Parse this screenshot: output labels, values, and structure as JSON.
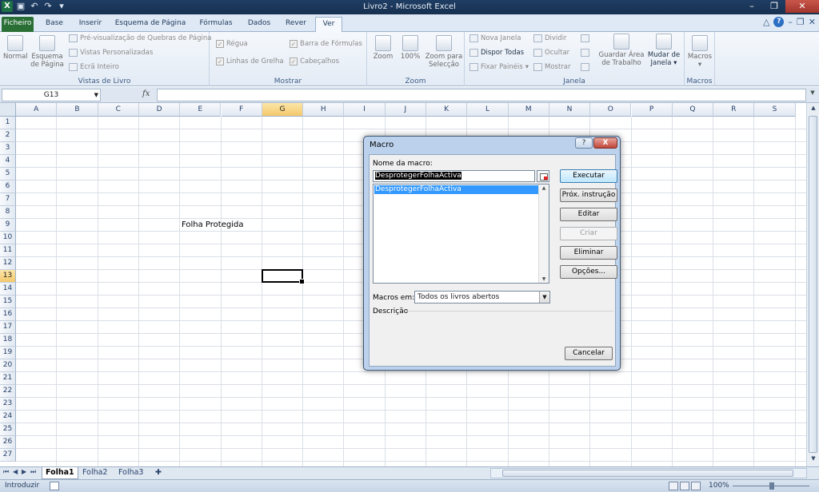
{
  "window": {
    "title": "Livro2 - Microsoft Excel"
  },
  "tabs": [
    {
      "label": "Ficheiro"
    },
    {
      "label": "Base"
    },
    {
      "label": "Inserir"
    },
    {
      "label": "Esquema de Página"
    },
    {
      "label": "Fórmulas"
    },
    {
      "label": "Dados"
    },
    {
      "label": "Rever"
    },
    {
      "label": "Ver"
    }
  ],
  "ribbon": {
    "workbook_views": {
      "label": "Vistas de Livro",
      "normal": "Normal",
      "page_layout_1": "Esquema",
      "page_layout_2": "de Página",
      "page_break_preview": "Pré-visualização de Quebras de Página",
      "custom_views": "Vistas Personalizadas",
      "full_screen": "Ecrã Inteiro"
    },
    "show": {
      "label": "Mostrar",
      "ruler": "Régua",
      "gridlines": "Linhas de Grelha",
      "formula_bar": "Barra de Fórmulas",
      "headings": "Cabeçalhos"
    },
    "zoom": {
      "label": "Zoom",
      "zoom": "Zoom",
      "hundred": "100%",
      "zoom_selection_1": "Zoom para",
      "zoom_selection_2": "Selecção"
    },
    "window": {
      "label": "Janela",
      "new_window": "Nova Janela",
      "arrange_all": "Dispor Todas",
      "freeze_panes": "Fixar Painéis",
      "split": "Dividir",
      "hide": "Ocultar",
      "unhide": "Mostrar",
      "save_workspace_1": "Guardar Área",
      "save_workspace_2": "de Trabalho",
      "switch_windows_1": "Mudar de",
      "switch_windows_2": "Janela"
    },
    "macros": {
      "label": "Macros",
      "macros": "Macros"
    }
  },
  "formula_bar": {
    "name_box": "G13",
    "fx": "fx",
    "formula": ""
  },
  "grid": {
    "columns": [
      "A",
      "B",
      "C",
      "D",
      "E",
      "F",
      "G",
      "H",
      "I",
      "J",
      "K",
      "L",
      "M",
      "N",
      "O",
      "P",
      "Q",
      "R",
      "S"
    ],
    "rows": [
      "1",
      "2",
      "3",
      "4",
      "5",
      "6",
      "7",
      "8",
      "9",
      "10",
      "11",
      "12",
      "13",
      "14",
      "15",
      "16",
      "17",
      "18",
      "19",
      "20",
      "21",
      "22",
      "23",
      "24",
      "25",
      "26",
      "27"
    ],
    "selected_column": "G",
    "selected_row": "13",
    "cell_e9": "Folha Protegida"
  },
  "sheets": [
    {
      "label": "Folha1"
    },
    {
      "label": "Folha2"
    },
    {
      "label": "Folha3"
    }
  ],
  "status": {
    "mode": "Introduzir",
    "zoom": "100%"
  },
  "dialog": {
    "title": "Macro",
    "help": "?",
    "close": "X",
    "name_label": "Nome da macro:",
    "name_value": "DesprotegerFolhaActiva",
    "list": [
      "DesprotegerFolhaActiva"
    ],
    "buttons": {
      "run": "Executar",
      "step_into": "Próx. instrução",
      "edit": "Editar",
      "create": "Criar",
      "delete": "Eliminar",
      "options": "Opções...",
      "cancel": "Cancelar"
    },
    "macros_in_label": "Macros em:",
    "macros_in_value": "Todos os livros abertos",
    "description_label": "Descrição"
  }
}
